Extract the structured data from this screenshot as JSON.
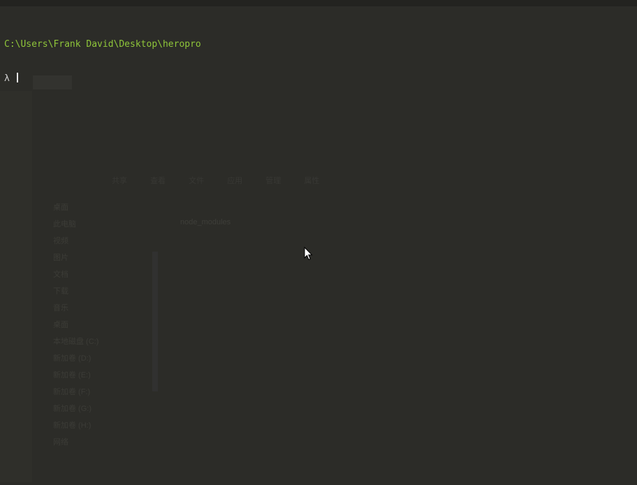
{
  "terminal": {
    "path": "C:\\Users\\Frank David\\Desktop\\heropro",
    "prompt_symbol": "λ"
  },
  "background_window": {
    "tabs": [
      "共享",
      "查看",
      "文件",
      "应用",
      "管理",
      "属性"
    ],
    "file_item": "node_modules",
    "sidebar_items": [
      "桌面",
      "此电脑",
      "视频",
      "图片",
      "文档",
      "下载",
      "音乐",
      "桌面",
      "本地磁盘 (C:)",
      "新加卷 (D:)",
      "新加卷 (E:)",
      "新加卷 (F:)",
      "新加卷 (G:)",
      "新加卷 (H:)",
      "网络"
    ]
  },
  "colors": {
    "background": "#2c2c28",
    "path_text": "#8fc63a",
    "prompt_text": "#d4d4d4"
  }
}
